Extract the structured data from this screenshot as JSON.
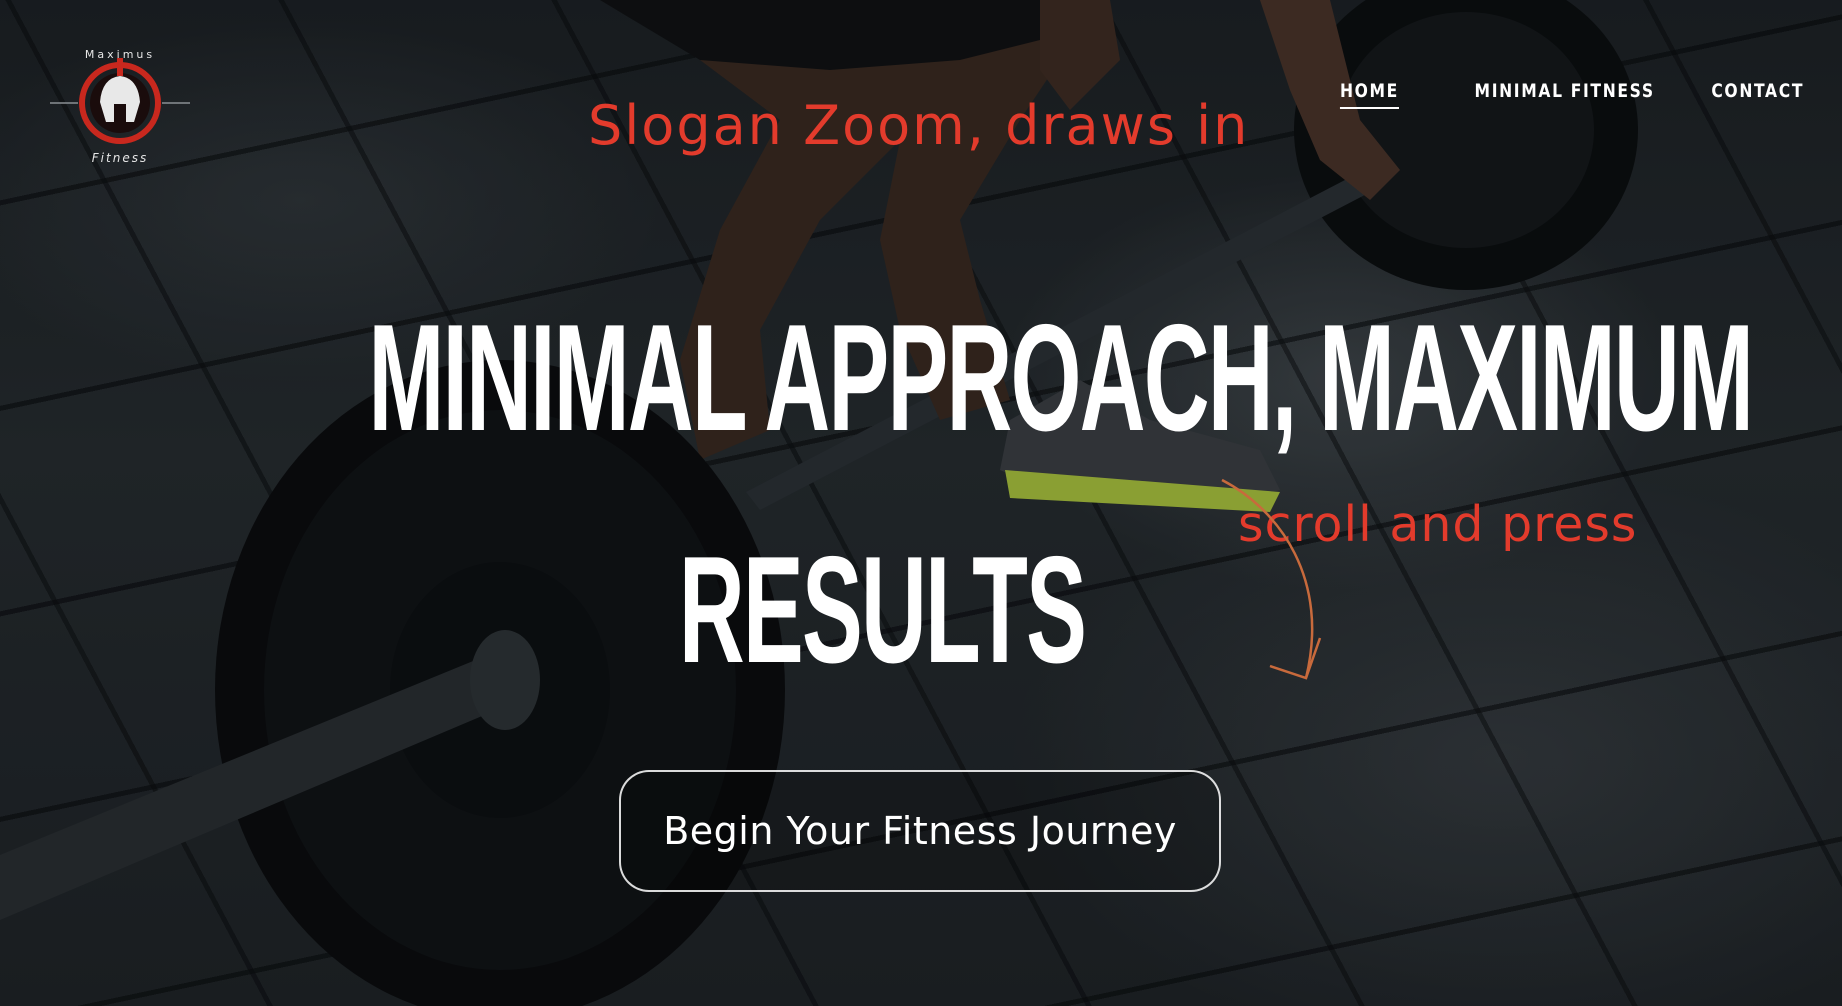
{
  "logo": {
    "top_text": "Maximus",
    "bottom_text": "Fitness"
  },
  "nav": {
    "items": [
      {
        "label": "HOME",
        "active": true
      },
      {
        "label": "MINIMAL FITNESS",
        "active": false
      },
      {
        "label": "CONTACT",
        "active": false
      }
    ]
  },
  "annotations": {
    "slogan_note": "Slogan Zoom, draws in",
    "scroll_note": "scroll and press"
  },
  "hero": {
    "headline_line1": "MINIMAL APPROACH, MAXIMUM",
    "headline_line2": "RESULTS",
    "cta_label": "Begin Your Fitness Journey"
  },
  "colors": {
    "annotation": "#e33b2c",
    "arrow": "#c86a3c",
    "logo_red": "#c8281e"
  },
  "icons": {
    "logo": "spartan-helmet-icon",
    "arrow": "curved-arrow-icon"
  }
}
